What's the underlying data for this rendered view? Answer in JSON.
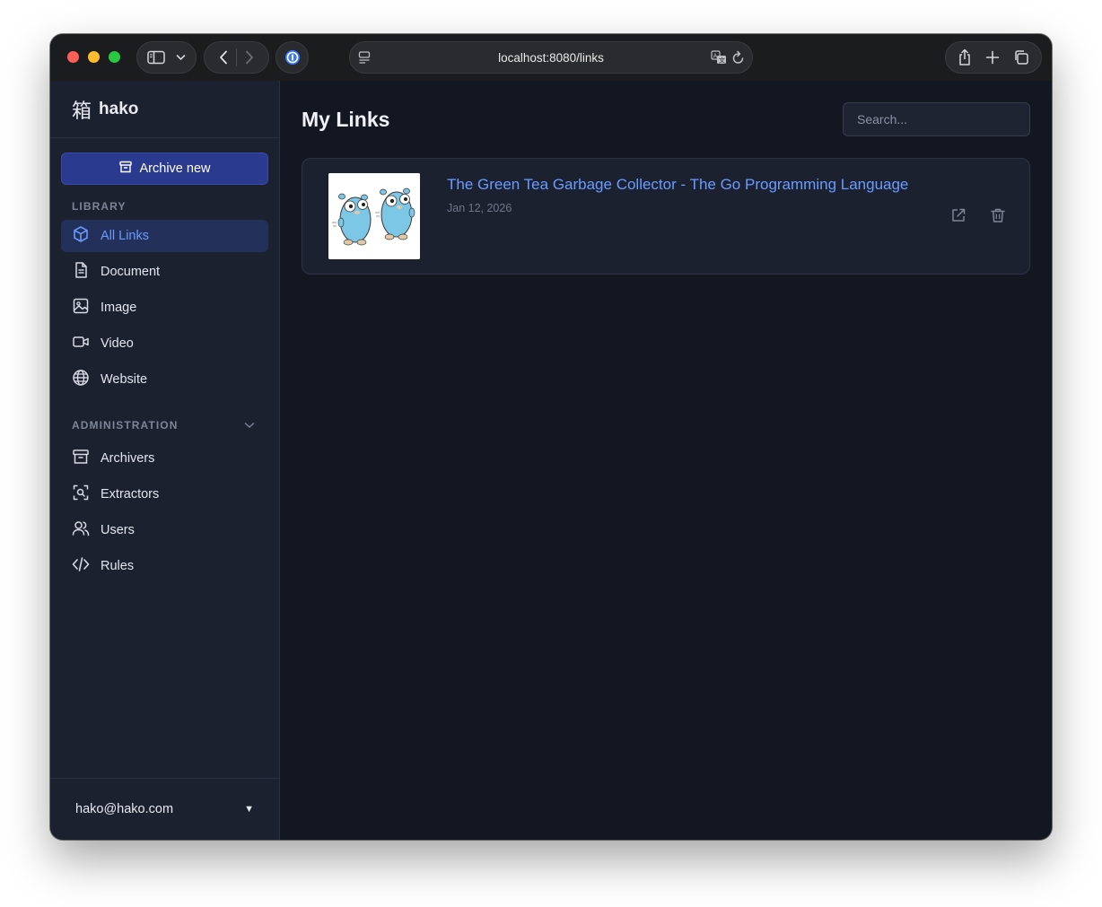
{
  "browser": {
    "url": "localhost:8080/links"
  },
  "app": {
    "brand_kanji": "箱",
    "brand_name": "hako",
    "archive_button": "Archive new",
    "library_label": "LIBRARY",
    "library_items": [
      {
        "label": "All Links",
        "icon": "cube-icon",
        "active": true
      },
      {
        "label": "Document",
        "icon": "document-icon"
      },
      {
        "label": "Image",
        "icon": "image-icon"
      },
      {
        "label": "Video",
        "icon": "video-icon"
      },
      {
        "label": "Website",
        "icon": "globe-icon"
      }
    ],
    "admin_label": "ADMINISTRATION",
    "admin_items": [
      {
        "label": "Archivers",
        "icon": "archive-icon"
      },
      {
        "label": "Extractors",
        "icon": "scan-icon"
      },
      {
        "label": "Users",
        "icon": "users-icon"
      },
      {
        "label": "Rules",
        "icon": "code-icon"
      }
    ],
    "user_email": "hako@hako.com",
    "user_caret": "▼"
  },
  "main": {
    "title": "My Links",
    "search_placeholder": "Search...",
    "links": [
      {
        "title": "The Green Tea Garbage Collector - The Go Programming Language",
        "date": "Jan 12, 2026",
        "thumbnail": "go-gophers-image"
      }
    ]
  },
  "colors": {
    "accent": "#6a9bff",
    "archive_button": "#2a3a8e",
    "sidebar_bg": "#1c2130",
    "main_bg": "#131722"
  }
}
